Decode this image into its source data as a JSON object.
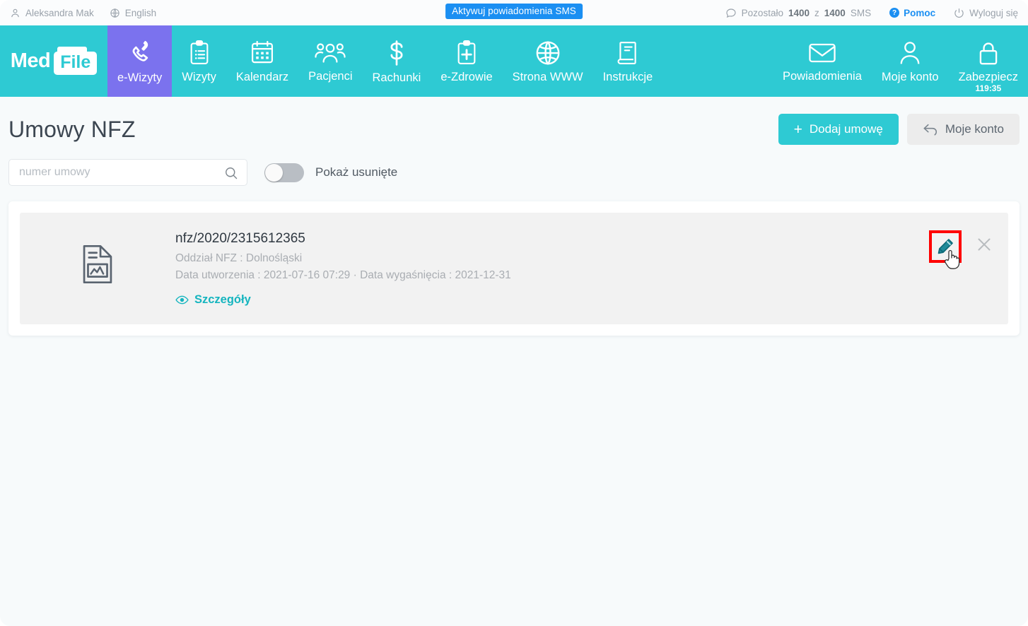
{
  "topbar": {
    "user": "Aleksandra Mak",
    "language": "English",
    "sms_badge": "Aktywuj powiadomienia SMS",
    "sms_remaining_prefix": "Pozostało ",
    "sms_remaining_count": "1400",
    "sms_remaining_mid": " z ",
    "sms_remaining_total": "1400",
    "sms_remaining_suffix": " SMS",
    "help": "Pomoc",
    "logout": "Wyloguj się"
  },
  "nav": {
    "logo_first": "Med",
    "logo_second": "File",
    "active_color": "#7b72ee",
    "bar_color": "#2ecad3",
    "items": [
      {
        "label": "e-Wizyty",
        "icon": "phone-icon",
        "active": true
      },
      {
        "label": "Wizyty",
        "icon": "clipboard-list-icon",
        "active": false
      },
      {
        "label": "Kalendarz",
        "icon": "calendar-icon",
        "active": false
      },
      {
        "label": "Pacjenci",
        "icon": "people-icon",
        "active": false
      },
      {
        "label": "Rachunki",
        "icon": "dollar-icon",
        "active": false
      },
      {
        "label": "e-Zdrowie",
        "icon": "clipboard-plus-icon",
        "active": false
      },
      {
        "label": "Strona WWW",
        "icon": "globe-icon",
        "active": false
      },
      {
        "label": "Instrukcje",
        "icon": "book-icon",
        "active": false
      }
    ],
    "right_items": [
      {
        "label": "Powiadomienia",
        "icon": "envelope-icon",
        "timer": ""
      },
      {
        "label": "Moje konto",
        "icon": "user-icon",
        "timer": ""
      },
      {
        "label": "Zabezpiecz",
        "icon": "lock-icon",
        "timer": "119:35"
      }
    ]
  },
  "page": {
    "title": "Umowy NFZ",
    "add_button": "Dodaj umowę",
    "add_button_plus": "+",
    "back_button": "Moje konto"
  },
  "filters": {
    "search_placeholder": "numer umowy",
    "search_value": "",
    "toggle_label": "Pokaż usunięte",
    "toggle_on": false
  },
  "list": {
    "rows": [
      {
        "icon": "document-chart-icon",
        "title": "nfz/2020/2315612365",
        "branch": "Oddział NFZ : Dolnośląski",
        "dates": "Data utworzenia : 2021-07-16 07:29 · Data wygaśnięcia : 2021-12-31",
        "details_label": "Szczegóły",
        "edit_icon": "pencil-icon",
        "delete_icon": "close-icon",
        "edit_highlight_color": "#ff0000"
      }
    ]
  }
}
